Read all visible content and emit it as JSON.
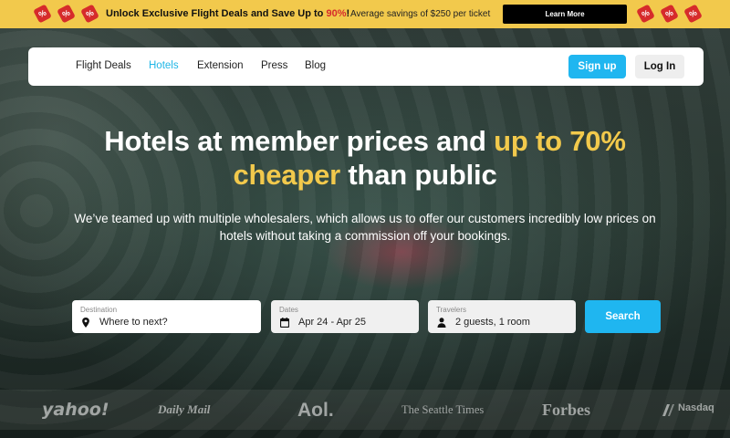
{
  "promo": {
    "tag_glyph": "%",
    "headline": "Unlock Exclusive Flight Deals and Save Up to ",
    "headline_pct": "90%",
    "headline_end": "!",
    "sub": "Average savings of $250 per ticket",
    "cta": "Learn More",
    "colors": {
      "banner": "#f2c94c",
      "tag": "#d62b2b",
      "cta_bg": "#000000"
    }
  },
  "nav": {
    "links": [
      "Flight Deals",
      "Hotels",
      "Extension",
      "Press",
      "Blog"
    ],
    "active": "Hotels",
    "signup": "Sign up",
    "login": "Log In",
    "colors": {
      "accent": "#1fb6f0"
    }
  },
  "hero": {
    "title_part1": "Hotels at member prices and ",
    "title_highlight1": "up to 70%",
    "title_highlight2": "cheaper",
    "title_part2": " than public",
    "subtitle": "We’ve teamed up with multiple wholesalers, which allows us to offer our customers incredibly low prices on hotels without taking a commission off your bookings.",
    "colors": {
      "highlight": "#f2c94c"
    }
  },
  "search": {
    "destination": {
      "label": "Destination",
      "placeholder": "Where to next?",
      "icon": "location-pin-icon"
    },
    "dates": {
      "label": "Dates",
      "value": "Apr 24 - Apr 25",
      "icon": "calendar-icon"
    },
    "travelers": {
      "label": "Travelers",
      "value": "2 guests, 1 room",
      "icon": "person-icon"
    },
    "button": "Search"
  },
  "press": {
    "logos": [
      "yahoo!",
      "Daily Mail",
      "Aol.",
      "The Seattle Times",
      "Forbes",
      "Nasdaq"
    ]
  }
}
